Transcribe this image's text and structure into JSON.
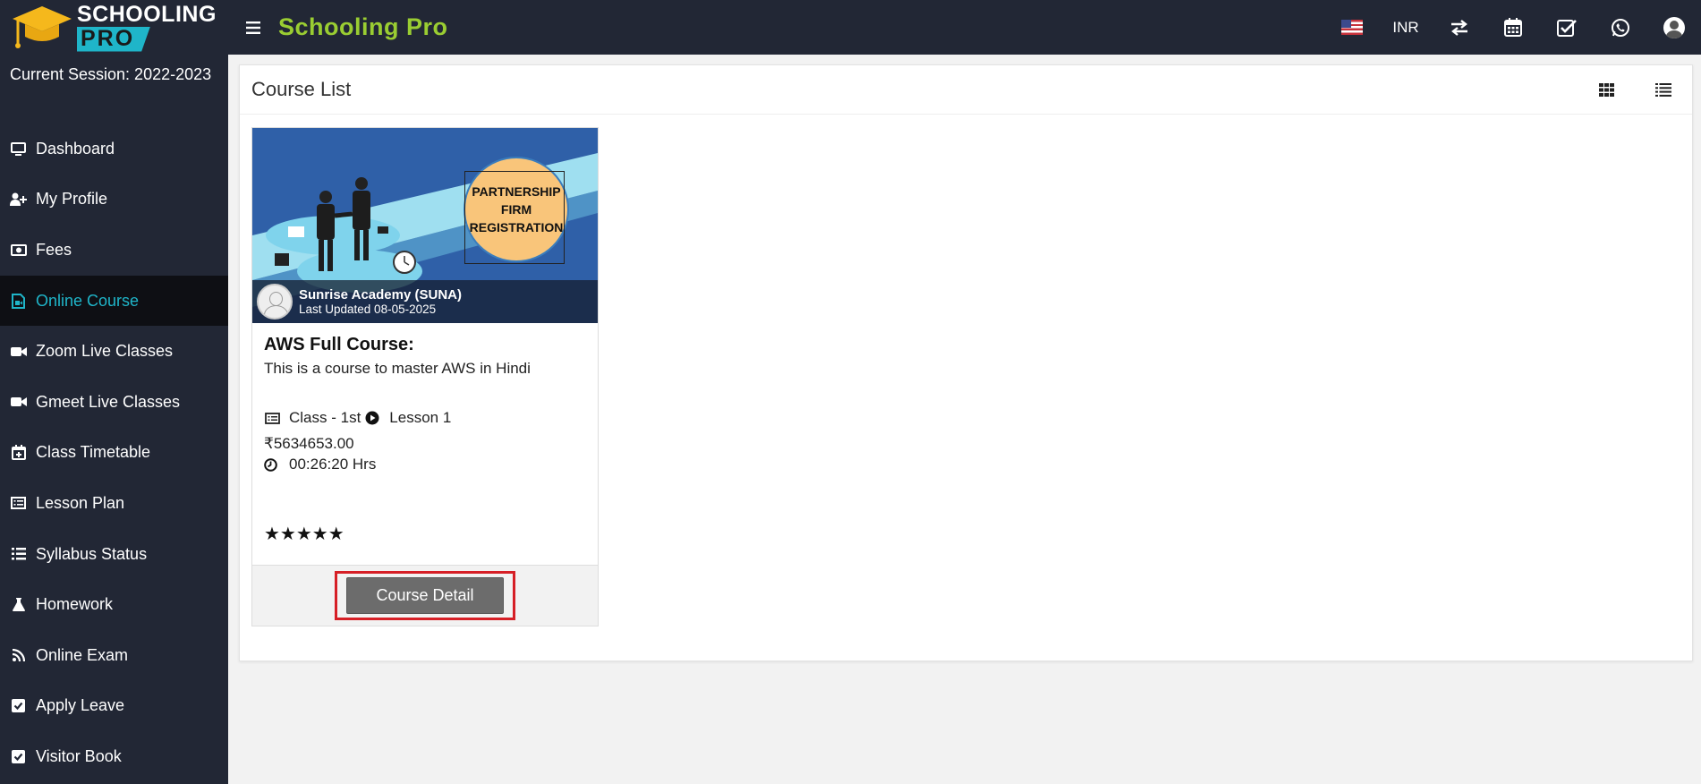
{
  "app": {
    "logo_line1": "SCHOOLING",
    "logo_line2": "PRO",
    "brand": "Schooling Pro",
    "currency": "INR",
    "brand_color": "#9acd32",
    "accent_color": "#1fb5c9"
  },
  "topbar": {
    "icons": [
      "us-flag-icon",
      "currency-selector",
      "switch-icon",
      "calendar-icon",
      "task-check-icon",
      "whatsapp-icon",
      "user-avatar-icon"
    ]
  },
  "sidebar": {
    "session": "Current Session: 2022-2023",
    "items": [
      {
        "label": "Dashboard",
        "icon": "desktop-icon"
      },
      {
        "label": "My Profile",
        "icon": "user-plus-icon"
      },
      {
        "label": "Fees",
        "icon": "money-icon"
      },
      {
        "label": "Online Course",
        "icon": "video-file-icon",
        "active": true
      },
      {
        "label": "Zoom Live Classes",
        "icon": "video-camera-icon"
      },
      {
        "label": "Gmeet Live Classes",
        "icon": "video-camera-icon"
      },
      {
        "label": "Class Timetable",
        "icon": "calendar-plus-icon"
      },
      {
        "label": "Lesson Plan",
        "icon": "list-alt-icon"
      },
      {
        "label": "Syllabus Status",
        "icon": "list-icon"
      },
      {
        "label": "Homework",
        "icon": "flask-icon"
      },
      {
        "label": "Online Exam",
        "icon": "rss-icon"
      },
      {
        "label": "Apply Leave",
        "icon": "check-square-icon"
      },
      {
        "label": "Visitor Book",
        "icon": "check-square-icon"
      }
    ]
  },
  "main": {
    "title": "Course List",
    "view_buttons": [
      "grid-view-icon",
      "list-view-icon"
    ],
    "course": {
      "thumb_text": "PARTNERSHIP\nFIRM\nREGISTRATION",
      "instructor": "Sunrise Academy (SUNA)",
      "updated": "Last Updated 08-05-2025",
      "title": "AWS Full Course:",
      "description": "This is a course to master AWS in Hindi",
      "class": "Class - 1st",
      "lesson": "Lesson 1",
      "price": "₹5634653.00",
      "duration": "00:26:20 Hrs",
      "rating": 5,
      "rating_text": "★★★★★",
      "button": "Course Detail"
    }
  }
}
